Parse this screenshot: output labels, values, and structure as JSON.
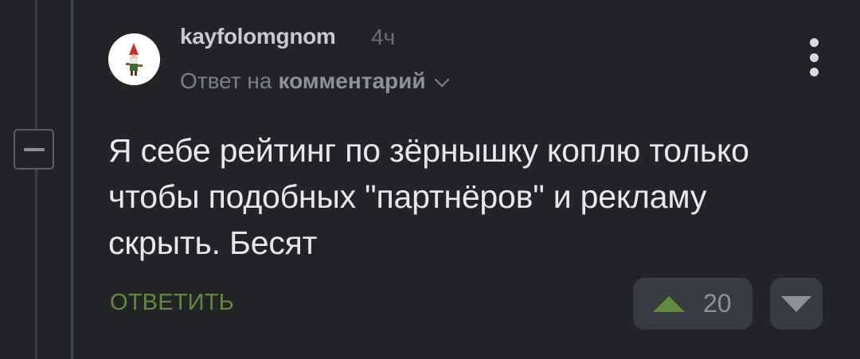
{
  "comment": {
    "author": "kayfolomgnom",
    "time_ago": "4ч",
    "reply_prefix": "Ответ на",
    "reply_target": "комментарий",
    "text": "Я себе рейтинг по зёрнышку коплю только чтобы подобных \"партнёров\" и рекламу скрыть. Бесят",
    "reply_label": "ОТВЕТИТЬ",
    "rating": "20"
  },
  "colors": {
    "background": "#222427",
    "reply_link": "#5e8a3c",
    "upvote_arrow": "#5e8a3c",
    "vote_button_bg": "#383b40"
  },
  "icons": {
    "avatar": "gnome-avatar-icon",
    "collapse": "minus-icon",
    "reply_dropdown": "chevron-down-icon",
    "more": "more-vertical-icon",
    "upvote": "triangle-up-icon",
    "downvote": "triangle-down-icon"
  }
}
